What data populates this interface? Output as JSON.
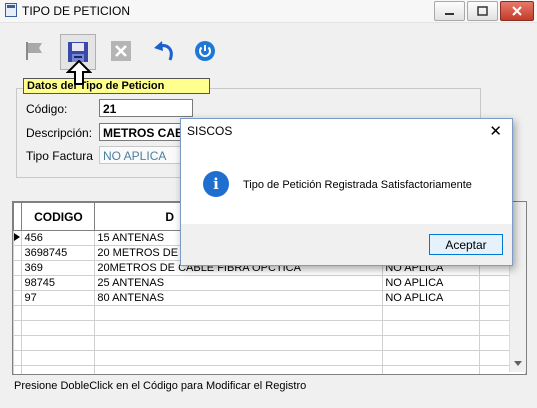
{
  "window": {
    "title": "TIPO DE PETICION"
  },
  "tooltip": {
    "text": "Datos del Tipo de Peticion"
  },
  "form": {
    "codigo_label": "Código:",
    "codigo_value": "21",
    "descripcion_label": "Descripción:",
    "descripcion_value": "METROS CAB",
    "tipo_factura_label": "Tipo Factura",
    "tipo_factura_value": "NO APLICA"
  },
  "grid": {
    "columns": [
      "CODIGO",
      "D",
      "",
      ""
    ],
    "rows": [
      {
        "codigo": "456",
        "descripcion": "15  ANTENAS",
        "tipo": ""
      },
      {
        "codigo": "3698745",
        "descripcion": "20 METROS DE C",
        "tipo": ""
      },
      {
        "codigo": "369",
        "descripcion": "20METROS DE CABLE FIBRA OPCTICA",
        "tipo": "NO APLICA"
      },
      {
        "codigo": "98745",
        "descripcion": "25 ANTENAS",
        "tipo": "NO APLICA"
      },
      {
        "codigo": "97",
        "descripcion": "80 ANTENAS",
        "tipo": "NO APLICA"
      }
    ]
  },
  "status": {
    "text": "Presione DobleClick en el Código para Modificar el Registro"
  },
  "dialog": {
    "title": "SISCOS",
    "message": "Tipo de Petición Registrada Satisfactoriamente",
    "accept_label": "Aceptar",
    "close_glyph": "✕"
  },
  "colors": {
    "tooltip_bg": "#ffff8e",
    "info_blue": "#1f6fd1",
    "dialog_border": "#7a9cc6"
  }
}
